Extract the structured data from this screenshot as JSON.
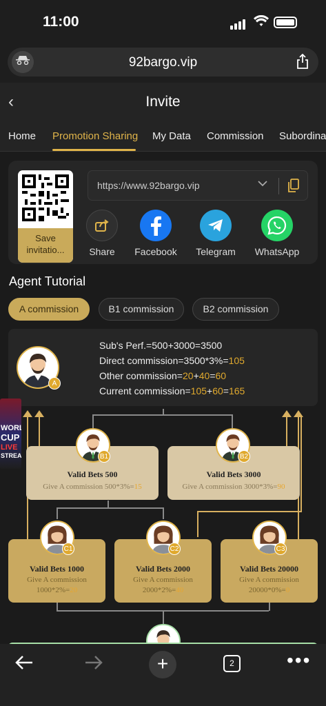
{
  "status": {
    "time": "11:00"
  },
  "browser": {
    "url": "92bargo.vip",
    "tab_count": "2"
  },
  "header": {
    "title": "Invite"
  },
  "tabs": [
    "Home",
    "Promotion Sharing",
    "My Data",
    "Commission",
    "Subordinate"
  ],
  "share": {
    "save_label": "Save invitatio...",
    "link": "https://www.92bargo.vip",
    "buttons": [
      {
        "label": "Share",
        "icon": "share-icon",
        "color": "#2f2f2f"
      },
      {
        "label": "Facebook",
        "icon": "facebook-icon",
        "color": "#1877f2"
      },
      {
        "label": "Telegram",
        "icon": "telegram-icon",
        "color": "#2aa3dd"
      },
      {
        "label": "WhatsApp",
        "icon": "whatsapp-icon",
        "color": "#25d366"
      }
    ]
  },
  "tutorial": {
    "title": "Agent Tutorial",
    "pills": [
      "A commission",
      "B1 commission",
      "B2 commission"
    ],
    "agent_badge": "A",
    "formula": {
      "line1": "Sub's Perf.=500+3000=3500",
      "line2_prefix": "Direct commission=3500*3%=",
      "line2_value": "105",
      "line3_prefix": "Other commission=",
      "line3_a": "20",
      "line3_plus": "+",
      "line3_b": "40",
      "line3_eq": "=",
      "line3_c": "60",
      "line4_prefix": "Current commission=",
      "line4_a": "105",
      "line4_plus": "+",
      "line4_b": "60",
      "line4_eq": "=",
      "line4_c": "165"
    },
    "nodes": {
      "b1": {
        "badge": "B1",
        "title": "Valid Bets 500",
        "desc": "Give A commission 500*3%=",
        "value": "15"
      },
      "b2": {
        "badge": "B2",
        "title": "Valid Bets 3000",
        "desc": "Give A commission 3000*3%=",
        "value": "90"
      },
      "c1": {
        "badge": "C1",
        "title": "Valid Bets 1000",
        "desc1": "Give A commission",
        "desc2": "1000*2%=",
        "value": "20"
      },
      "c2": {
        "badge": "C2",
        "title": "Valid Bets 2000",
        "desc1": "Give A commission",
        "desc2": "2000*2%=",
        "value": "40"
      },
      "c3": {
        "badge": "C3",
        "title": "Valid Bets 20000",
        "desc1": "Give A commission",
        "desc2": "20000*0%=",
        "value": "0"
      }
    }
  },
  "side_banner": {
    "line1": "WORLD",
    "line2": "CUP",
    "line3": "LIVE",
    "line4": "STREAM"
  },
  "colors": {
    "accent": "#e0b44a",
    "gold_button": "#c9aa5a",
    "highlight": "#e0a92e"
  }
}
